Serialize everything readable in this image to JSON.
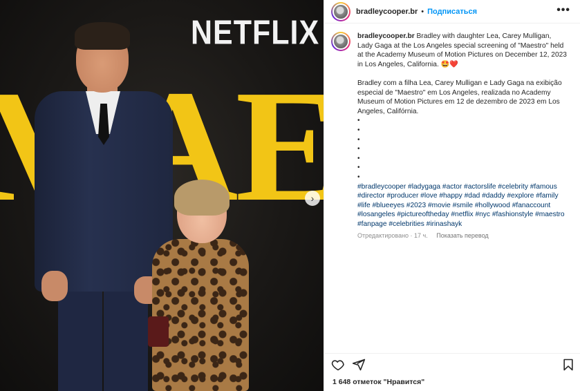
{
  "photo": {
    "backdrop_brand": "NETFLIX",
    "backdrop_title": "MAESTRO",
    "next_glyph": "›"
  },
  "header": {
    "username": "bradleycooper.br",
    "separator": "•",
    "follow_label": "Подписаться",
    "more_glyph": "•••"
  },
  "caption": {
    "username": "bradleycooper.br",
    "text_en": "Bradley with daughter Lea, Carey Mulligan, Lady Gaga at the Los Angeles special screening of \"Maestro\" held at the Academy Museum of Motion Pictures on December 12, 2023 in Los Angeles, California. 🤩❤️",
    "text_pt": "Bradley com a filha Lea, Carey Mulligan e Lady Gaga na exibição especial de \"Maestro\" em Los Angeles, realizada no Academy Museum of Motion Pictures em 12 de dezembro de 2023 em Los Angeles, Califórnia.",
    "bullets": [
      "•",
      "•",
      "•",
      "•",
      "•",
      "•",
      "•"
    ],
    "hashtags": "#bradleycooper #ladygaga #actor #actorslife #celebrity #famous #director #producer #love #happy #dad #daddy #explore #family #life #blueeyes #2023 #movie #smile #hollywood #fanaccount #losangeles #pictureoftheday #netflix #nyc #fashionstyle #maestro #fanpage #celebrities #irinashayk",
    "edited_time": "Отредактировано · 17 ч.",
    "translate_label": "Показать перевод"
  },
  "actions": {
    "like_icon": "heart-icon",
    "share_icon": "send-icon",
    "save_icon": "bookmark-icon"
  },
  "likes_text": "1 648 отметок \"Нравится\""
}
